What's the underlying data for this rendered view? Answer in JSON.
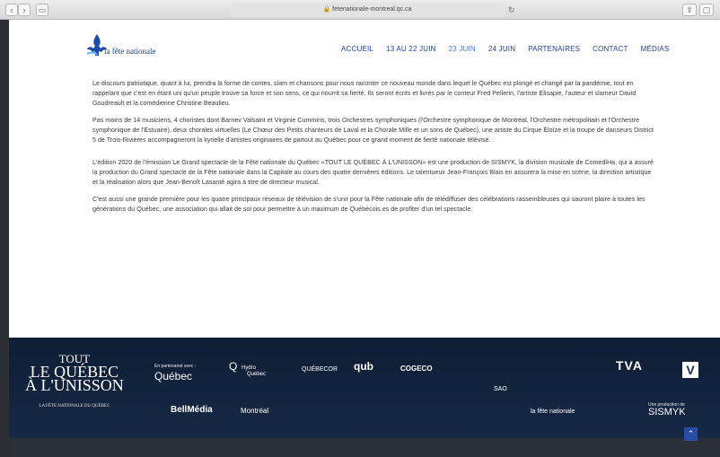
{
  "browser": {
    "url": "fetenationale-montreal.qc.ca"
  },
  "header": {
    "logo_text": "la fête nationale",
    "menu": [
      "ACCUEIL",
      "13 AU 22 JUIN",
      "23 JUIN",
      "24 JUIN",
      "PARTENAIRES",
      "CONTACT",
      "MÉDIAS"
    ],
    "active": "23 JUIN"
  },
  "content": {
    "p1": "Le discours patriotique, quant à lui, prendra la forme de contes, slam et chansons pour nous raconter ce nouveau monde dans lequel le Québec est plongé et changé par la pandémie, tout en rappelant que c'est en étant uni qu'un peuple trouve sa force et son sens, ce qui nourrit sa fierté. Ils seront écrits et livrés par le conteur Fred Pellerin, l'artiste Elisapie, l'auteur et slameur David Goudreault et la comédienne Christine Beaulieu.",
    "p2": "Pas moins de 14 musiciens, 4 choristes dont Barnev Valsaint et Virginie Cummins, trois Orchestres symphoniques (l'Orchestre symphonique de Montréal, l'Orchestre métropolitain et l'Orchestre symphonique de l'Estuaire), deux chorales virtuelles (Le Chœur des Petits chanteurs de Laval et la Chorale Mille et un sons de Québec), une artiste du Cirque Éloïze et la troupe de danseurs District 5 de Trois-Rivières accompagneront la kyrielle d'artistes originaires de partout au Québec pour ce grand moment de fierté nationale télévisé.",
    "p3": "L'édition 2020 de l'émission Le Grand spectacle de la Fête nationale du Québec «TOUT LE QUÉBEC À L'UNISSON» est une production de SISMYK, la division musicale de ComediHa, qui a assuré la production du Grand spectacle de la Fête nationale dans la Capitale au cours des quatre dernières éditions. Le talentueux Jean-François Blais en assurera la mise en scène, la direction artistique et la réalisation alors que Jean-Benoît Lasanté agira à titre de directeur musical.",
    "p4": "C'est aussi une grande première pour les quatre principaux réseaux de télévision de s'unir pour la Fête nationale afin de télédiffuser des célébrations rassembleuses qui sauront plaire à toutes les générations du Québec, une association qui allait de soi pour permettre à un maximum de Québécois.es de profiter d'un tel spectacle."
  },
  "footer": {
    "title1": "TOUT",
    "title2": "LE QUÉBEC",
    "title3": "À L'UNISSON",
    "title_small": "LA FÊTE NATIONALE DU QUÉBEC",
    "partnership": "En partenariat avec :",
    "quebec": "Québec",
    "hydro_top": "Hydro",
    "hydro_bottom": "Québec",
    "quebecor": "QUÉBECOR",
    "qub": "qub",
    "cogeco": "COGECO",
    "sao": "SAO",
    "tva": "TVA",
    "v": "V",
    "bellmedia": "BellMédia",
    "montreal": "Montréal",
    "lafete": "la fête nationale",
    "production": "Une production de",
    "sismyk": "SISMYK"
  }
}
